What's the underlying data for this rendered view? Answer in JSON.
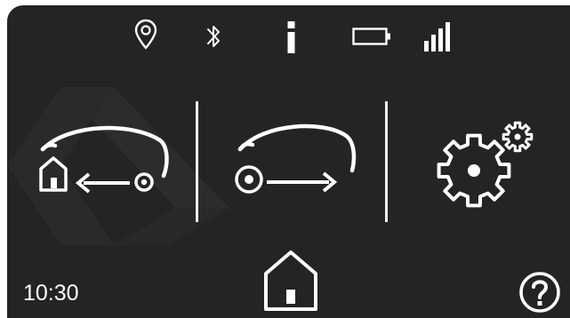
{
  "status_bar": {
    "icons": [
      "location-pin-icon",
      "bluetooth-icon",
      "info-icon",
      "battery-icon",
      "signal-strength-icon"
    ],
    "signal_bars": 4,
    "battery_level": 0
  },
  "main_actions": [
    {
      "name": "return-to-base",
      "icon": "mower-return-home-icon"
    },
    {
      "name": "start-mowing",
      "icon": "mower-start-icon"
    },
    {
      "name": "settings",
      "icon": "settings-gears-icon"
    }
  ],
  "footer": {
    "clock": "10:30",
    "home_icon": "home-icon",
    "help_icon": "help-icon"
  },
  "colors": {
    "screen_background": "#242424",
    "foreground": "#ffffff",
    "bezel": "#ffffff"
  }
}
